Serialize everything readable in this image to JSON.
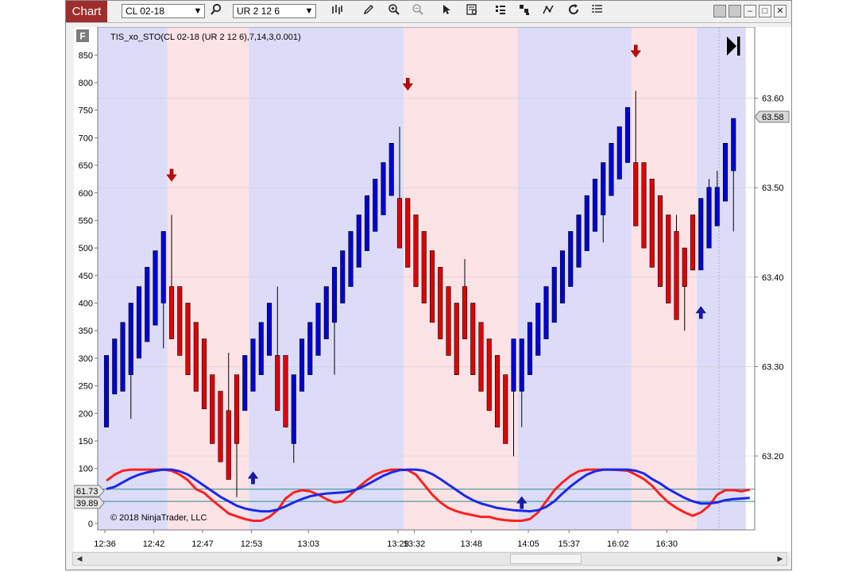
{
  "toolbar": {
    "chart_tab": "Chart",
    "instrument": "CL 02-18",
    "bar_type": "UR 2 12 6",
    "icons": [
      "search-icon",
      "bars-type-icon",
      "pencil-icon",
      "zoom-in-icon",
      "zoom-out-icon",
      "pointer-icon",
      "data-box-icon",
      "strategies-icon",
      "indicators-icon",
      "drawing-tools-icon",
      "reload-icon",
      "properties-icon"
    ],
    "window_buttons": [
      "minimize",
      "maximize",
      "restore",
      "close"
    ]
  },
  "chart": {
    "panel_badge": "F",
    "indicator_label": "TIS_xo_STO(CL 02-18 (UR 2 12 6),7,14,3,0.001)",
    "copyright": "© 2018 NinjaTrader, LLC",
    "left_axis_ticks": [
      "0",
      "50",
      "100",
      "150",
      "200",
      "250",
      "300",
      "350",
      "400",
      "450",
      "500",
      "550",
      "600",
      "650",
      "700",
      "750",
      "800",
      "850"
    ],
    "right_axis_ticks": [
      "63.20",
      "63.30",
      "63.40",
      "63.50",
      "63.60"
    ],
    "price_marker": "63.58",
    "level_marker_upper": "61.73",
    "level_marker_lower": "39.89",
    "x_axis_ticks": [
      "12:36",
      "12:42",
      "12:47",
      "12:53",
      "13:03",
      "13:29",
      "13:32",
      "13:48",
      "14:05",
      "15:37",
      "16:02",
      "16:30"
    ],
    "colors": {
      "up_bar": "#0000d6",
      "down_bar": "#e00000",
      "blue_zone": "#dcdcf8",
      "red_zone": "#fde2e6",
      "fast_line": "#ff2020",
      "slow_line": "#1a28e6",
      "level_line": "#2a8c8c"
    }
  },
  "chart_data": {
    "type": "candlestick",
    "left_axis_range": [
      0,
      875
    ],
    "right_axis_range": [
      63.13,
      63.67
    ],
    "candles_left_scale": [
      {
        "o": 175,
        "c": 305,
        "h": 305,
        "l": 175,
        "dir": "up"
      },
      {
        "o": 235,
        "c": 335,
        "h": 335,
        "l": 235,
        "dir": "up"
      },
      {
        "o": 240,
        "c": 365,
        "h": 365,
        "l": 240,
        "dir": "up"
      },
      {
        "o": 270,
        "c": 400,
        "h": 400,
        "l": 190,
        "dir": "up"
      },
      {
        "o": 300,
        "c": 430,
        "h": 430,
        "l": 300,
        "dir": "up"
      },
      {
        "o": 330,
        "c": 465,
        "h": 465,
        "l": 330,
        "dir": "up"
      },
      {
        "o": 360,
        "c": 495,
        "h": 495,
        "l": 360,
        "dir": "up"
      },
      {
        "o": 400,
        "c": 530,
        "h": 530,
        "l": 318,
        "dir": "up"
      },
      {
        "o": 430,
        "c": 335,
        "h": 560,
        "l": 335,
        "dir": "down"
      },
      {
        "o": 430,
        "c": 305,
        "h": 430,
        "l": 305,
        "dir": "down"
      },
      {
        "o": 400,
        "c": 270,
        "h": 400,
        "l": 270,
        "dir": "down"
      },
      {
        "o": 365,
        "c": 240,
        "h": 365,
        "l": 240,
        "dir": "down"
      },
      {
        "o": 335,
        "c": 208,
        "h": 335,
        "l": 208,
        "dir": "down"
      },
      {
        "o": 270,
        "c": 145,
        "h": 270,
        "l": 145,
        "dir": "down"
      },
      {
        "o": 240,
        "c": 112,
        "h": 240,
        "l": 112,
        "dir": "down"
      },
      {
        "o": 205,
        "c": 80,
        "h": 310,
        "l": 80,
        "dir": "down"
      },
      {
        "o": 270,
        "c": 145,
        "h": 270,
        "l": 48,
        "dir": "down"
      },
      {
        "o": 205,
        "c": 305,
        "h": 305,
        "l": 205,
        "dir": "up"
      },
      {
        "o": 240,
        "c": 335,
        "h": 335,
        "l": 240,
        "dir": "up"
      },
      {
        "o": 270,
        "c": 365,
        "h": 365,
        "l": 270,
        "dir": "up"
      },
      {
        "o": 305,
        "c": 400,
        "h": 400,
        "l": 305,
        "dir": "up"
      },
      {
        "o": 305,
        "c": 205,
        "h": 430,
        "l": 205,
        "dir": "down"
      },
      {
        "o": 305,
        "c": 175,
        "h": 305,
        "l": 175,
        "dir": "down"
      },
      {
        "o": 145,
        "c": 270,
        "h": 270,
        "l": 110,
        "dir": "up"
      },
      {
        "o": 240,
        "c": 335,
        "h": 335,
        "l": 240,
        "dir": "up"
      },
      {
        "o": 270,
        "c": 365,
        "h": 365,
        "l": 270,
        "dir": "up"
      },
      {
        "o": 305,
        "c": 400,
        "h": 400,
        "l": 305,
        "dir": "up"
      },
      {
        "o": 335,
        "c": 430,
        "h": 430,
        "l": 335,
        "dir": "up"
      },
      {
        "o": 365,
        "c": 465,
        "h": 465,
        "l": 270,
        "dir": "up"
      },
      {
        "o": 400,
        "c": 495,
        "h": 495,
        "l": 400,
        "dir": "up"
      },
      {
        "o": 430,
        "c": 530,
        "h": 530,
        "l": 430,
        "dir": "up"
      },
      {
        "o": 465,
        "c": 560,
        "h": 560,
        "l": 465,
        "dir": "up"
      },
      {
        "o": 495,
        "c": 595,
        "h": 595,
        "l": 495,
        "dir": "up"
      },
      {
        "o": 530,
        "c": 625,
        "h": 625,
        "l": 530,
        "dir": "up"
      },
      {
        "o": 560,
        "c": 655,
        "h": 655,
        "l": 560,
        "dir": "up"
      },
      {
        "o": 595,
        "c": 690,
        "h": 690,
        "l": 595,
        "dir": "up"
      },
      {
        "o": 590,
        "c": 500,
        "h": 720,
        "l": 500,
        "dir": "down"
      },
      {
        "o": 590,
        "c": 465,
        "h": 590,
        "l": 465,
        "dir": "down"
      },
      {
        "o": 560,
        "c": 430,
        "h": 560,
        "l": 430,
        "dir": "down"
      },
      {
        "o": 530,
        "c": 400,
        "h": 530,
        "l": 400,
        "dir": "down"
      },
      {
        "o": 495,
        "c": 365,
        "h": 495,
        "l": 365,
        "dir": "down"
      },
      {
        "o": 465,
        "c": 335,
        "h": 465,
        "l": 335,
        "dir": "down"
      },
      {
        "o": 430,
        "c": 305,
        "h": 430,
        "l": 305,
        "dir": "down"
      },
      {
        "o": 400,
        "c": 270,
        "h": 400,
        "l": 270,
        "dir": "down"
      },
      {
        "o": 430,
        "c": 335,
        "h": 480,
        "l": 335,
        "dir": "down"
      },
      {
        "o": 400,
        "c": 270,
        "h": 400,
        "l": 270,
        "dir": "down"
      },
      {
        "o": 365,
        "c": 240,
        "h": 365,
        "l": 240,
        "dir": "down"
      },
      {
        "o": 335,
        "c": 205,
        "h": 335,
        "l": 205,
        "dir": "down"
      },
      {
        "o": 305,
        "c": 175,
        "h": 305,
        "l": 175,
        "dir": "down"
      },
      {
        "o": 270,
        "c": 145,
        "h": 270,
        "l": 145,
        "dir": "down"
      },
      {
        "o": 240,
        "c": 335,
        "h": 335,
        "l": 122,
        "dir": "up"
      },
      {
        "o": 240,
        "c": 335,
        "h": 335,
        "l": 175,
        "dir": "up"
      },
      {
        "o": 270,
        "c": 365,
        "h": 365,
        "l": 270,
        "dir": "up"
      },
      {
        "o": 305,
        "c": 400,
        "h": 400,
        "l": 305,
        "dir": "up"
      },
      {
        "o": 335,
        "c": 430,
        "h": 430,
        "l": 335,
        "dir": "up"
      },
      {
        "o": 365,
        "c": 465,
        "h": 465,
        "l": 365,
        "dir": "up"
      },
      {
        "o": 400,
        "c": 495,
        "h": 495,
        "l": 400,
        "dir": "up"
      },
      {
        "o": 430,
        "c": 530,
        "h": 530,
        "l": 430,
        "dir": "up"
      },
      {
        "o": 465,
        "c": 560,
        "h": 560,
        "l": 465,
        "dir": "up"
      },
      {
        "o": 495,
        "c": 595,
        "h": 595,
        "l": 495,
        "dir": "up"
      },
      {
        "o": 530,
        "c": 625,
        "h": 625,
        "l": 530,
        "dir": "up"
      },
      {
        "o": 560,
        "c": 655,
        "h": 655,
        "l": 510,
        "dir": "up"
      },
      {
        "o": 595,
        "c": 690,
        "h": 690,
        "l": 595,
        "dir": "up"
      },
      {
        "o": 625,
        "c": 720,
        "h": 720,
        "l": 625,
        "dir": "up"
      },
      {
        "o": 655,
        "c": 755,
        "h": 755,
        "l": 655,
        "dir": "up"
      },
      {
        "o": 655,
        "c": 540,
        "h": 785,
        "l": 540,
        "dir": "down"
      },
      {
        "o": 655,
        "c": 500,
        "h": 655,
        "l": 500,
        "dir": "down"
      },
      {
        "o": 625,
        "c": 465,
        "h": 625,
        "l": 465,
        "dir": "down"
      },
      {
        "o": 595,
        "c": 430,
        "h": 595,
        "l": 430,
        "dir": "down"
      },
      {
        "o": 560,
        "c": 400,
        "h": 560,
        "l": 400,
        "dir": "down"
      },
      {
        "o": 530,
        "c": 370,
        "h": 560,
        "l": 370,
        "dir": "down"
      },
      {
        "o": 500,
        "c": 430,
        "h": 500,
        "l": 350,
        "dir": "down"
      },
      {
        "o": 560,
        "c": 460,
        "h": 560,
        "l": 460,
        "dir": "down"
      },
      {
        "o": 460,
        "c": 590,
        "h": 590,
        "l": 460,
        "dir": "up"
      },
      {
        "o": 500,
        "c": 610,
        "h": 625,
        "l": 500,
        "dir": "up"
      },
      {
        "o": 540,
        "c": 610,
        "h": 640,
        "l": 540,
        "dir": "up"
      },
      {
        "o": 585,
        "c": 690,
        "h": 690,
        "l": 585,
        "dir": "up"
      },
      {
        "o": 640,
        "c": 735,
        "h": 735,
        "l": 530,
        "dir": "up"
      }
    ],
    "zones": [
      {
        "from": 0,
        "to": 7,
        "color": "blue"
      },
      {
        "from": 8,
        "to": 17,
        "color": "red"
      },
      {
        "from": 18,
        "to": 36,
        "color": "blue"
      },
      {
        "from": 37,
        "to": 50,
        "color": "red"
      },
      {
        "from": 51,
        "to": 64,
        "color": "blue"
      },
      {
        "from": 65,
        "to": 72,
        "color": "red"
      },
      {
        "from": 73,
        "to": 78,
        "color": "blue"
      }
    ],
    "signals": [
      {
        "bar": 8,
        "dir": "down",
        "value": 630
      },
      {
        "bar": 18,
        "dir": "up",
        "value": 85
      },
      {
        "bar": 37,
        "dir": "down",
        "value": 795
      },
      {
        "bar": 51,
        "dir": "up",
        "value": 40
      },
      {
        "bar": 65,
        "dir": "down",
        "value": 855
      },
      {
        "bar": 73,
        "dir": "up",
        "value": 385
      }
    ],
    "oscillator_fast": [
      77,
      88,
      95,
      97,
      97,
      97,
      97,
      97,
      95,
      88,
      78,
      62,
      55,
      42,
      30,
      18,
      13,
      8,
      5,
      5,
      12,
      24,
      45,
      56,
      60,
      58,
      52,
      44,
      38,
      40,
      52,
      66,
      78,
      88,
      94,
      97,
      97,
      96,
      88,
      70,
      52,
      38,
      28,
      22,
      18,
      15,
      12,
      12,
      8,
      6,
      5,
      5,
      8,
      20,
      40,
      60,
      74,
      86,
      94,
      97,
      97,
      97,
      97,
      96,
      95,
      88,
      80,
      68,
      52,
      38,
      28,
      20,
      14,
      20,
      32,
      52,
      60,
      60,
      58,
      61
    ],
    "oscillator_slow": [
      62,
      66,
      74,
      82,
      88,
      92,
      95,
      97,
      97,
      94,
      88,
      78,
      68,
      58,
      48,
      40,
      32,
      27,
      24,
      22,
      22,
      25,
      31,
      38,
      44,
      49,
      52,
      54,
      55,
      56,
      58,
      63,
      70,
      78,
      86,
      92,
      96,
      97,
      97,
      95,
      89,
      80,
      70,
      60,
      50,
      42,
      36,
      32,
      28,
      26,
      24,
      23,
      22,
      24,
      30,
      40,
      54,
      67,
      78,
      88,
      94,
      97,
      97,
      97,
      97,
      95,
      90,
      80,
      72,
      62,
      54,
      46,
      40,
      36,
      36,
      38,
      42,
      44,
      45,
      46
    ],
    "level_upper": 61.73,
    "level_lower": 39.89,
    "current_price": 63.58
  }
}
